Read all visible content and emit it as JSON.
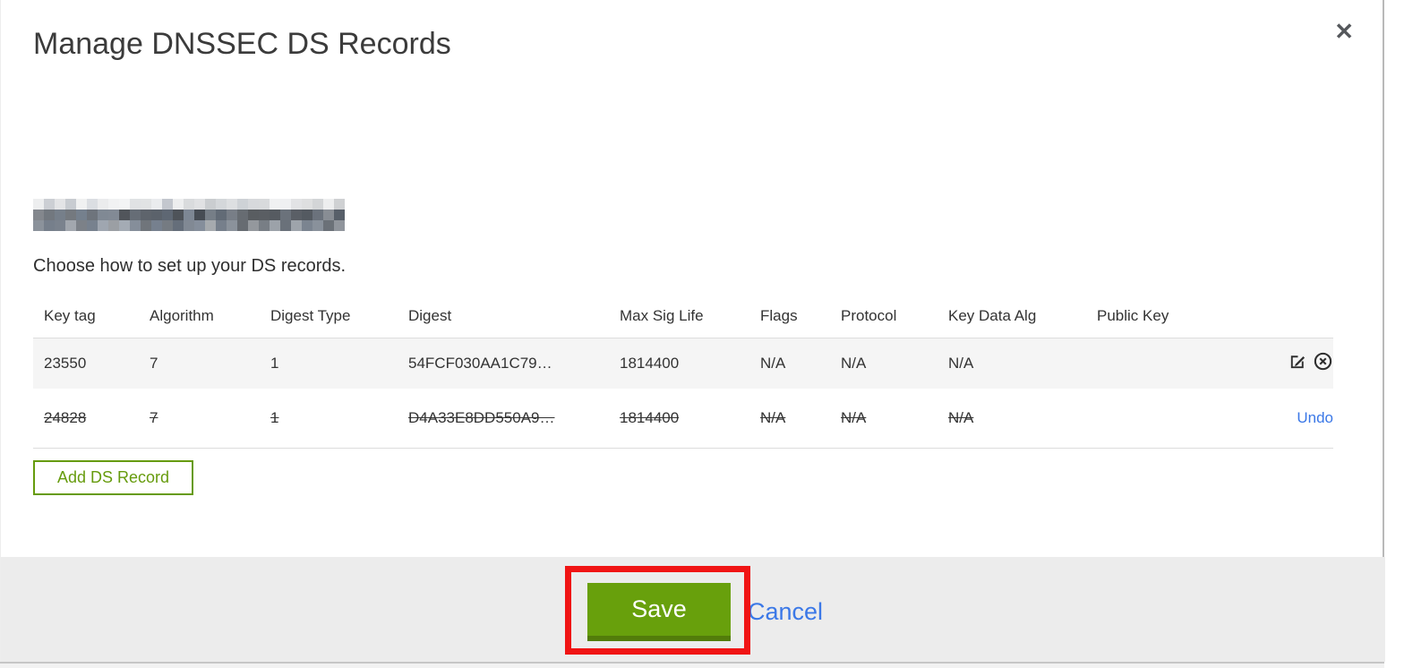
{
  "dialog": {
    "title": "Manage DNSSEC DS Records",
    "close_icon": "✕",
    "domain_redacted": true,
    "subtitle": "Choose how to set up your DS records.",
    "table": {
      "headers": [
        "Key tag",
        "Algorithm",
        "Digest Type",
        "Digest",
        "Max Sig Life",
        "Flags",
        "Protocol",
        "Key Data Alg",
        "Public Key"
      ],
      "rows": [
        {
          "key_tag": "23550",
          "algorithm": "7",
          "digest_type": "1",
          "digest": "54FCF030AA1C79…",
          "max_sig_life": "1814400",
          "flags": "N/A",
          "protocol": "N/A",
          "key_data_alg": "N/A",
          "public_key": "",
          "state": "active",
          "actions": [
            "edit-icon",
            "delete-icon"
          ]
        },
        {
          "key_tag": "24828",
          "algorithm": "7",
          "digest_type": "1",
          "digest": "D4A33E8DD550A9…",
          "max_sig_life": "1814400",
          "flags": "N/A",
          "protocol": "N/A",
          "key_data_alg": "N/A",
          "public_key": "",
          "state": "deleted",
          "undo_label": "Undo"
        }
      ]
    },
    "add_record_button": "Add DS Record",
    "footer": {
      "save": "Save",
      "cancel": "Cancel"
    },
    "colors": {
      "green_border": "#669b0d",
      "green_button": "#68a00c",
      "green_button_shadow": "#527c0a",
      "link_blue": "#3b78e7",
      "annotation_red": "#f01414"
    }
  }
}
